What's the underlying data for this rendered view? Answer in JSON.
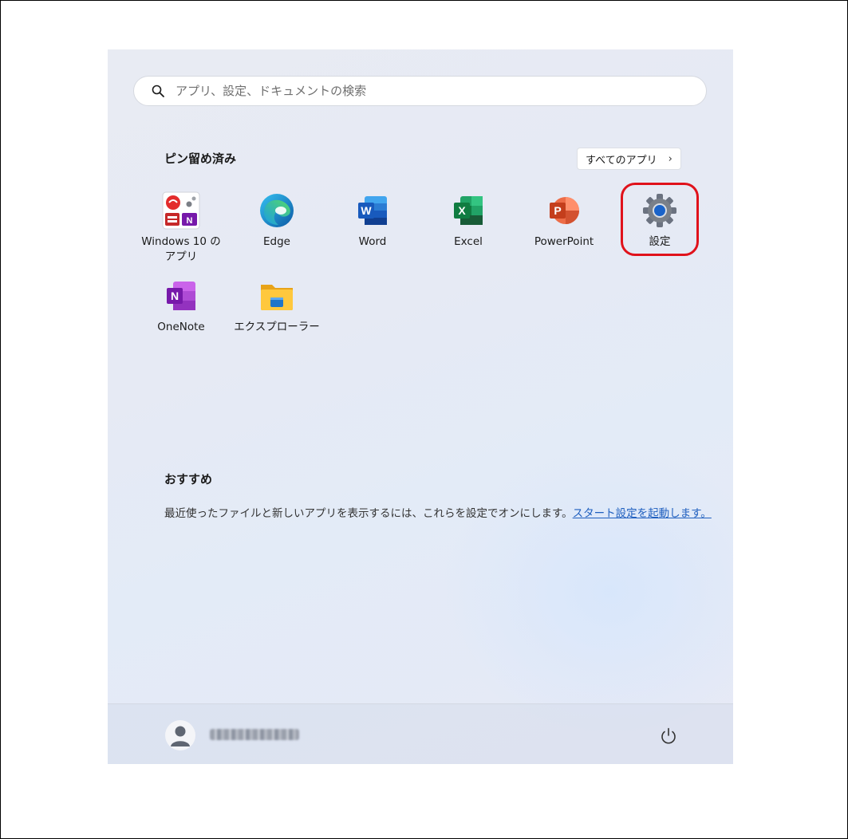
{
  "search": {
    "placeholder": "アプリ、設定、ドキュメントの検索"
  },
  "pinned": {
    "title": "ピン留め済み",
    "all_apps_label": "すべてのアプリ",
    "apps": [
      {
        "label": "Windows 10 のアプリ",
        "icon": "windows10-apps-folder-icon"
      },
      {
        "label": "Edge",
        "icon": "edge-icon"
      },
      {
        "label": "Word",
        "icon": "word-icon"
      },
      {
        "label": "Excel",
        "icon": "excel-icon"
      },
      {
        "label": "PowerPoint",
        "icon": "powerpoint-icon"
      },
      {
        "label": "設定",
        "icon": "settings-gear-icon"
      },
      {
        "label": "OneNote",
        "icon": "onenote-icon"
      },
      {
        "label": "エクスプローラー",
        "icon": "file-explorer-icon"
      }
    ]
  },
  "recommended": {
    "title": "おすすめ",
    "message": "最近使ったファイルと新しいアプリを表示するには、これらを設定でオンにします。",
    "link": "スタート設定を起動します。"
  },
  "footer": {
    "user_name": "■■■■■■■■"
  },
  "colors": {
    "highlight": "#e0121b",
    "link": "#1f5fbf"
  }
}
